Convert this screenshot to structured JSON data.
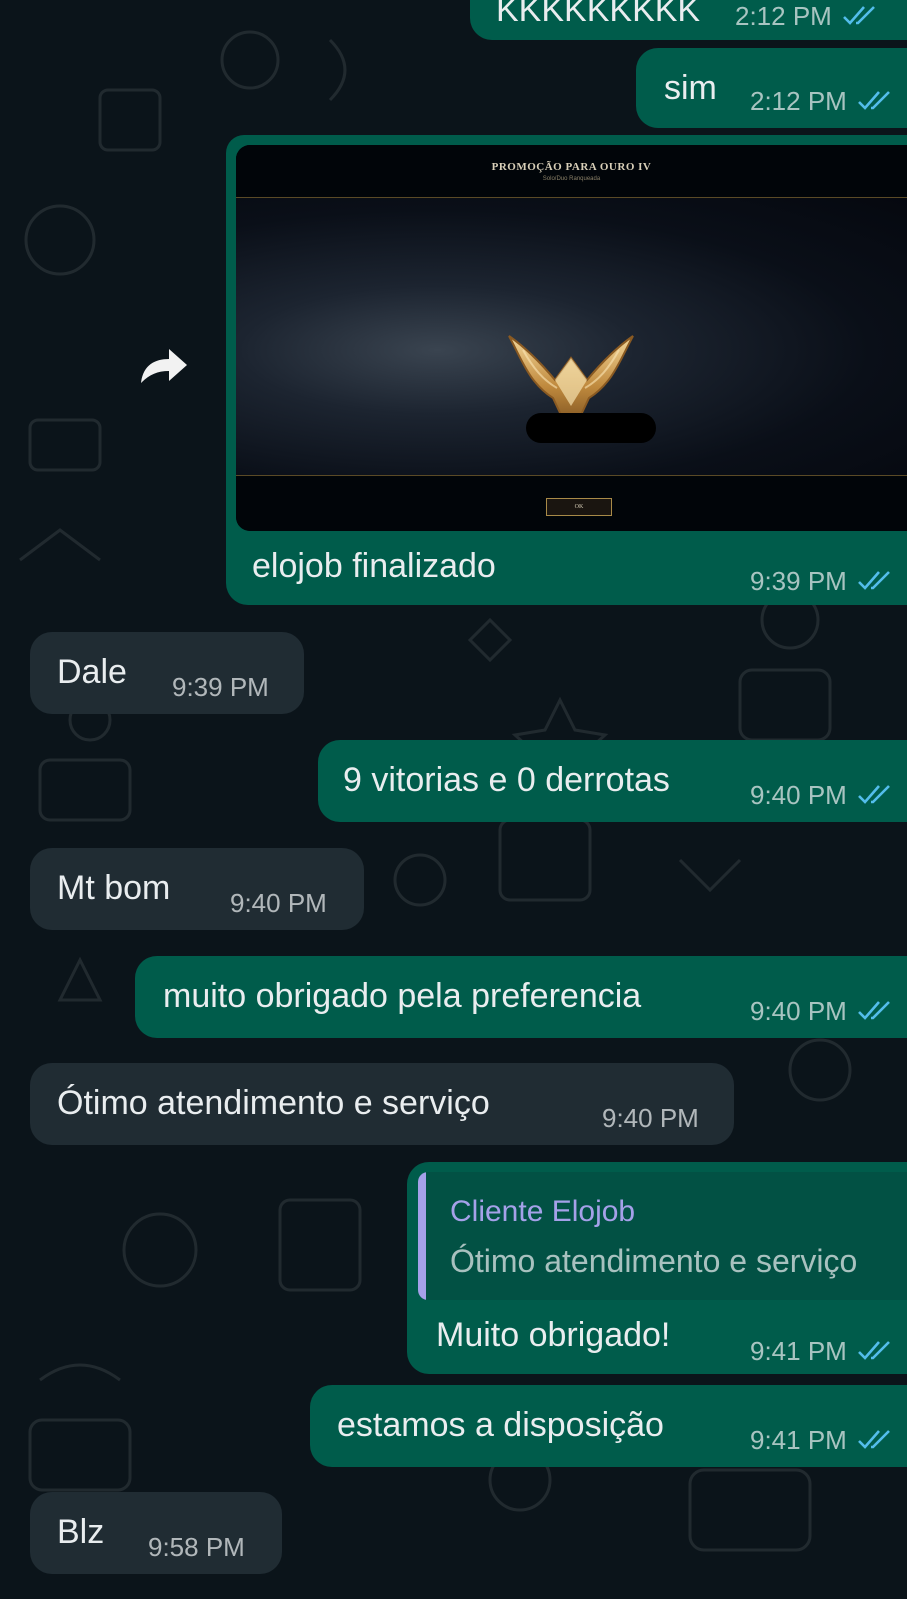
{
  "theme": {
    "background": "#0b141a",
    "outgoing_bubble": "#005c4b",
    "incoming_bubble": "#202c33",
    "quote_accent": "#a5a1e9",
    "read_tick": "#53bdeb"
  },
  "messages": [
    {
      "direction": "outgoing",
      "text": "KKKKKKKKK",
      "time": "2:12 PM",
      "status": "read"
    },
    {
      "direction": "outgoing",
      "text": "sim",
      "time": "2:12 PM",
      "status": "read"
    },
    {
      "direction": "outgoing",
      "text": "elojob finalizado",
      "time": "9:39 PM",
      "status": "read",
      "image": {
        "title": "PROMOÇÃO PARA OURO IV",
        "subtitle": "Solo/Duo Ranqueada",
        "button": "OK",
        "emblem": "gold-rank-emblem-icon"
      }
    },
    {
      "direction": "incoming",
      "text": "Dale",
      "time": "9:39 PM"
    },
    {
      "direction": "outgoing",
      "text": "9 vitorias e 0 derrotas",
      "time": "9:40 PM",
      "status": "read"
    },
    {
      "direction": "incoming",
      "text": "Mt bom",
      "time": "9:40 PM"
    },
    {
      "direction": "outgoing",
      "text": "muito obrigado pela preferencia",
      "time": "9:40 PM",
      "status": "read"
    },
    {
      "direction": "incoming",
      "text": "Ótimo atendimento e serviço",
      "time": "9:40 PM"
    },
    {
      "direction": "outgoing",
      "text": "Muito obrigado!",
      "time": "9:41 PM",
      "status": "read",
      "quote": {
        "author": "Cliente Elojob",
        "text": "Ótimo atendimento e serviço"
      }
    },
    {
      "direction": "outgoing",
      "text": "estamos a disposição",
      "time": "9:41 PM",
      "status": "read"
    },
    {
      "direction": "incoming",
      "text": "Blz",
      "time": "9:58 PM"
    }
  ],
  "icons": {
    "forward": "forward-arrow-icon",
    "read_receipt": "double-check-icon"
  }
}
